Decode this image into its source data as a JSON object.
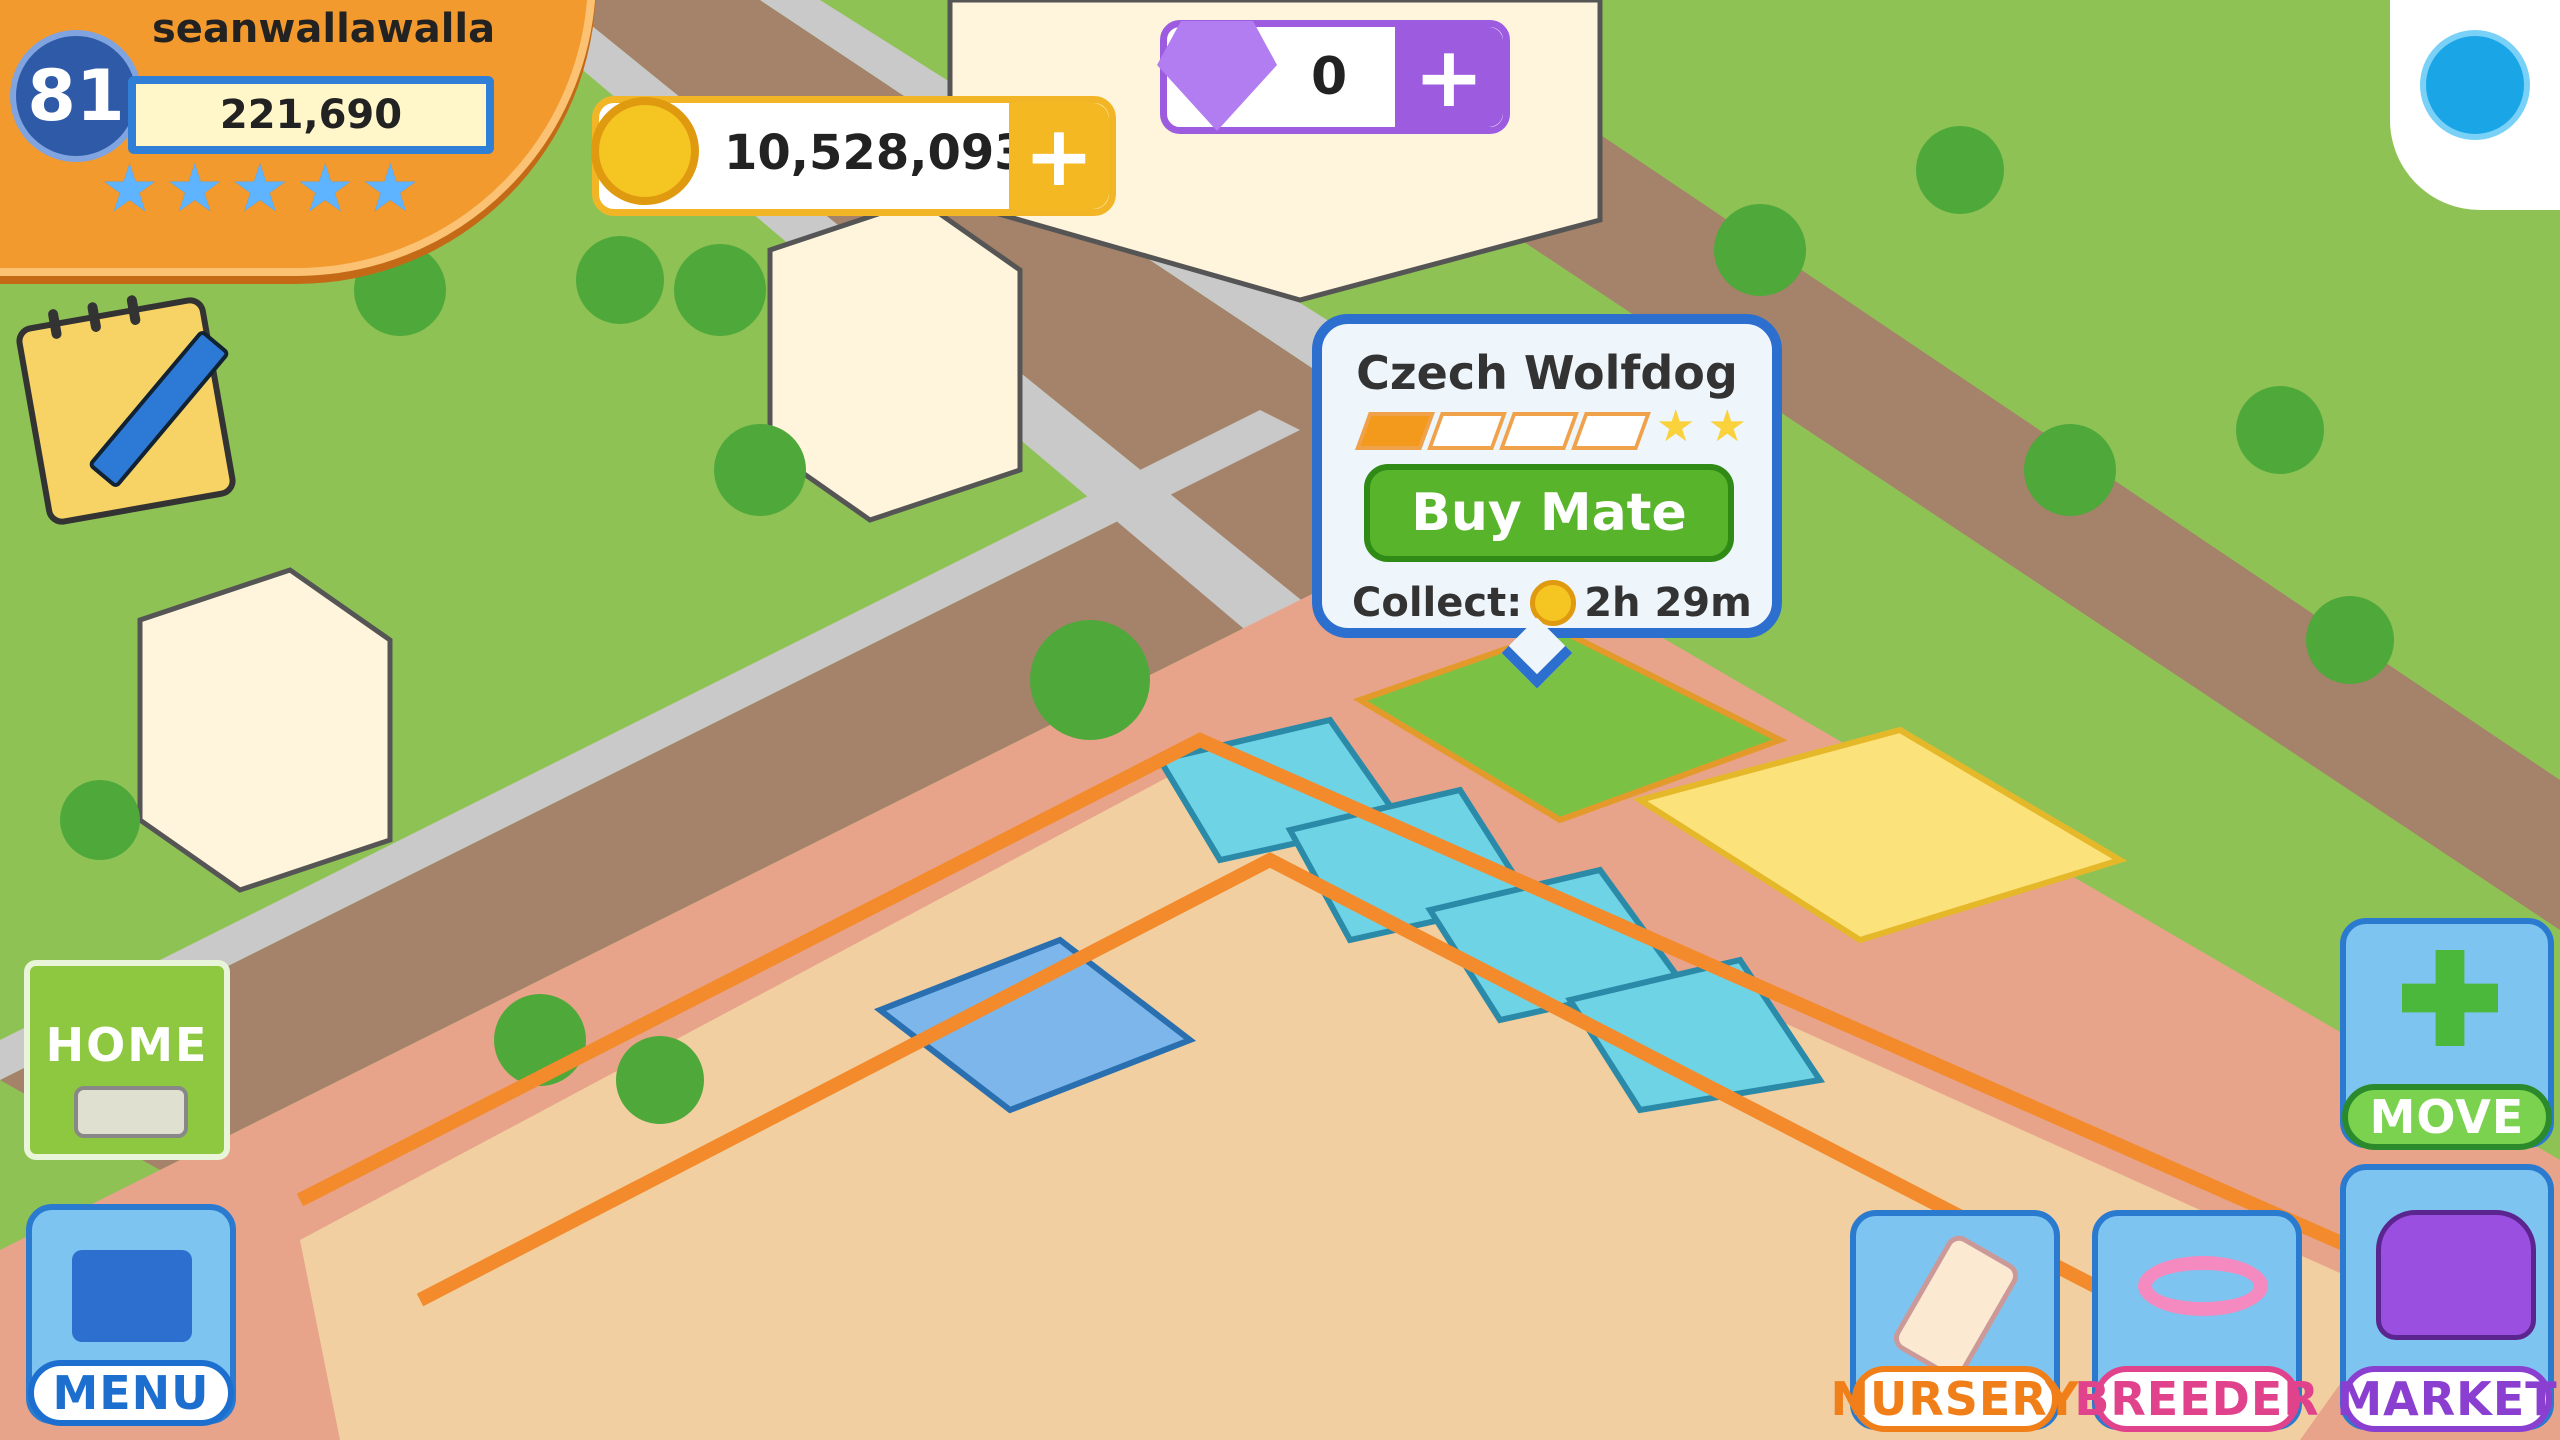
{
  "player": {
    "level": "81",
    "username": "seanwallawalla",
    "xp": "221,690",
    "stars": 5
  },
  "currency": {
    "coins": "10,528,093",
    "gems": "0"
  },
  "popup": {
    "pet_name": "Czech Wolfdog",
    "progress_filled": 1,
    "progress_total": 4,
    "button_label": "Buy Mate",
    "collect_label": "Collect:",
    "collect_time": "2h 29m"
  },
  "buttons": {
    "home": "HOME",
    "menu": "MENU",
    "nursery": "NURSERY",
    "breeder": "BREEDER",
    "market": "MARKET",
    "move": "MOVE"
  },
  "colors": {
    "grass": "#8fc255",
    "road": "#a5826a",
    "plaza": "#e8a48a",
    "accent_blue": "#2d6fcf",
    "accent_orange": "#f29a2e"
  }
}
